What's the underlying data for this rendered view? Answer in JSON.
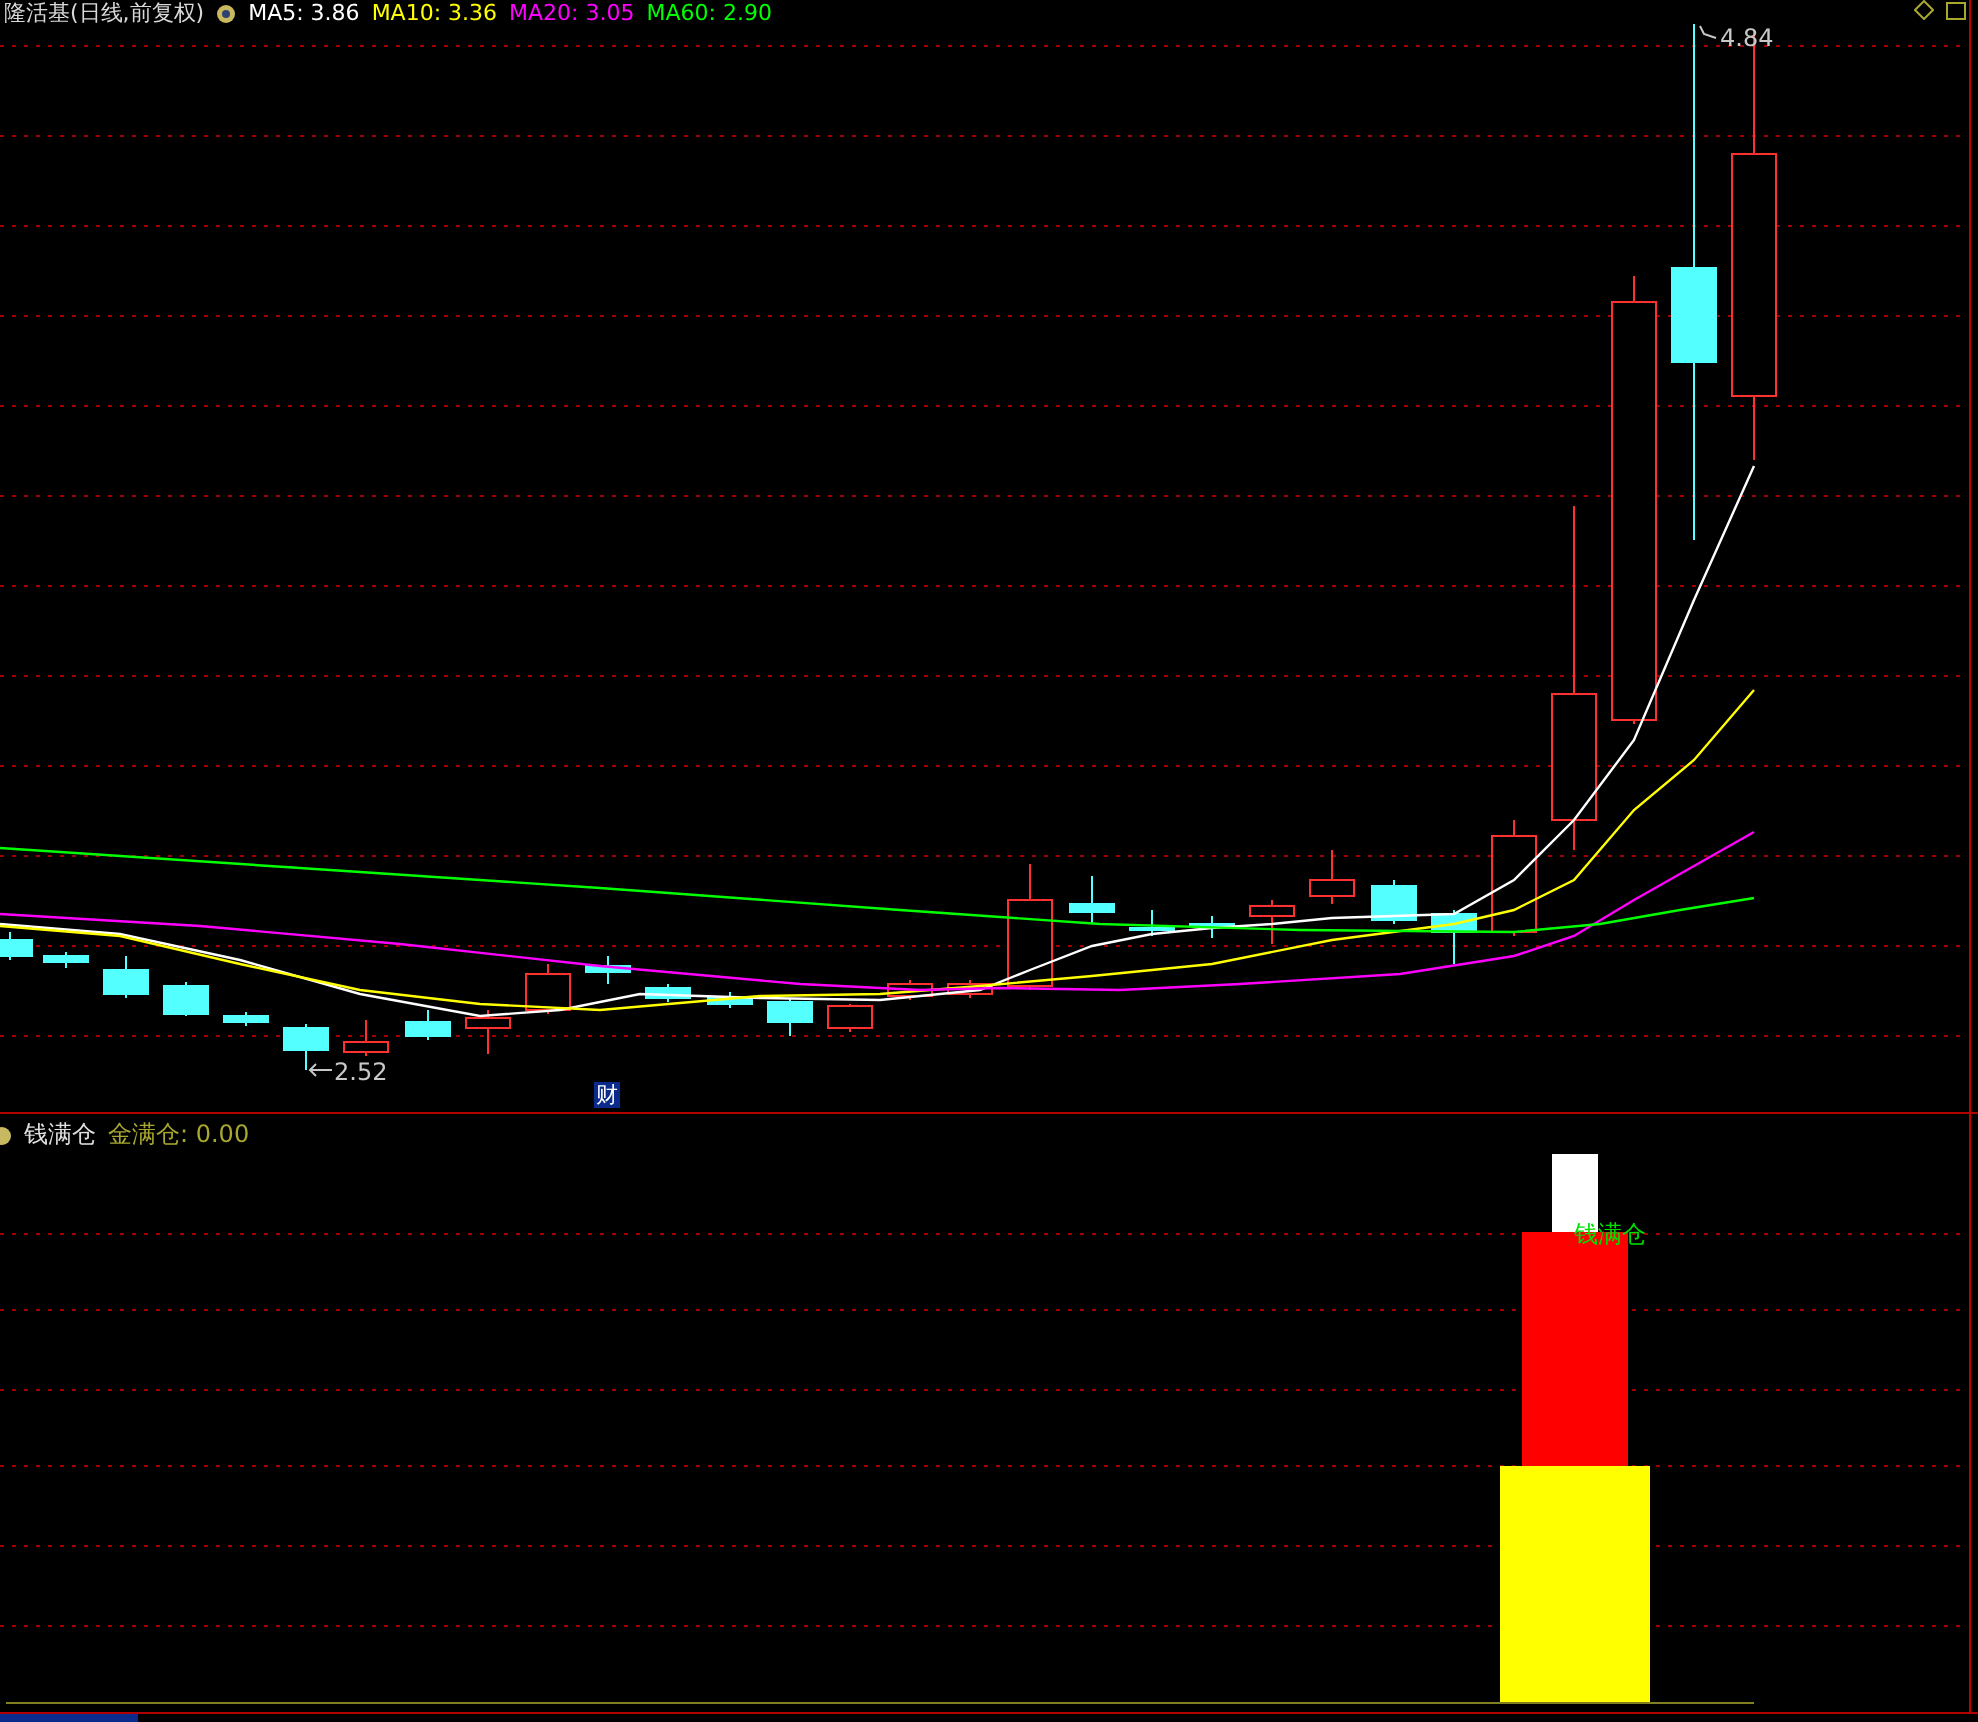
{
  "header": {
    "title": "隆活基(日线,前复权)",
    "indicators": [
      {
        "label": "MA5: 3.86",
        "color": "#ffffff"
      },
      {
        "label": "MA10: 3.36",
        "color": "#ffff00"
      },
      {
        "label": "MA20: 3.05",
        "color": "#ff00ff"
      },
      {
        "label": "MA60: 2.90",
        "color": "#00ff00"
      }
    ]
  },
  "price_chart": {
    "high_label": "4.84",
    "low_label": "2.52",
    "finance_marker": "财"
  },
  "indicator_panel": {
    "name": "钱满仓",
    "legend": "金满仓: 0.00",
    "bar_label": "钱满仓"
  }
}
